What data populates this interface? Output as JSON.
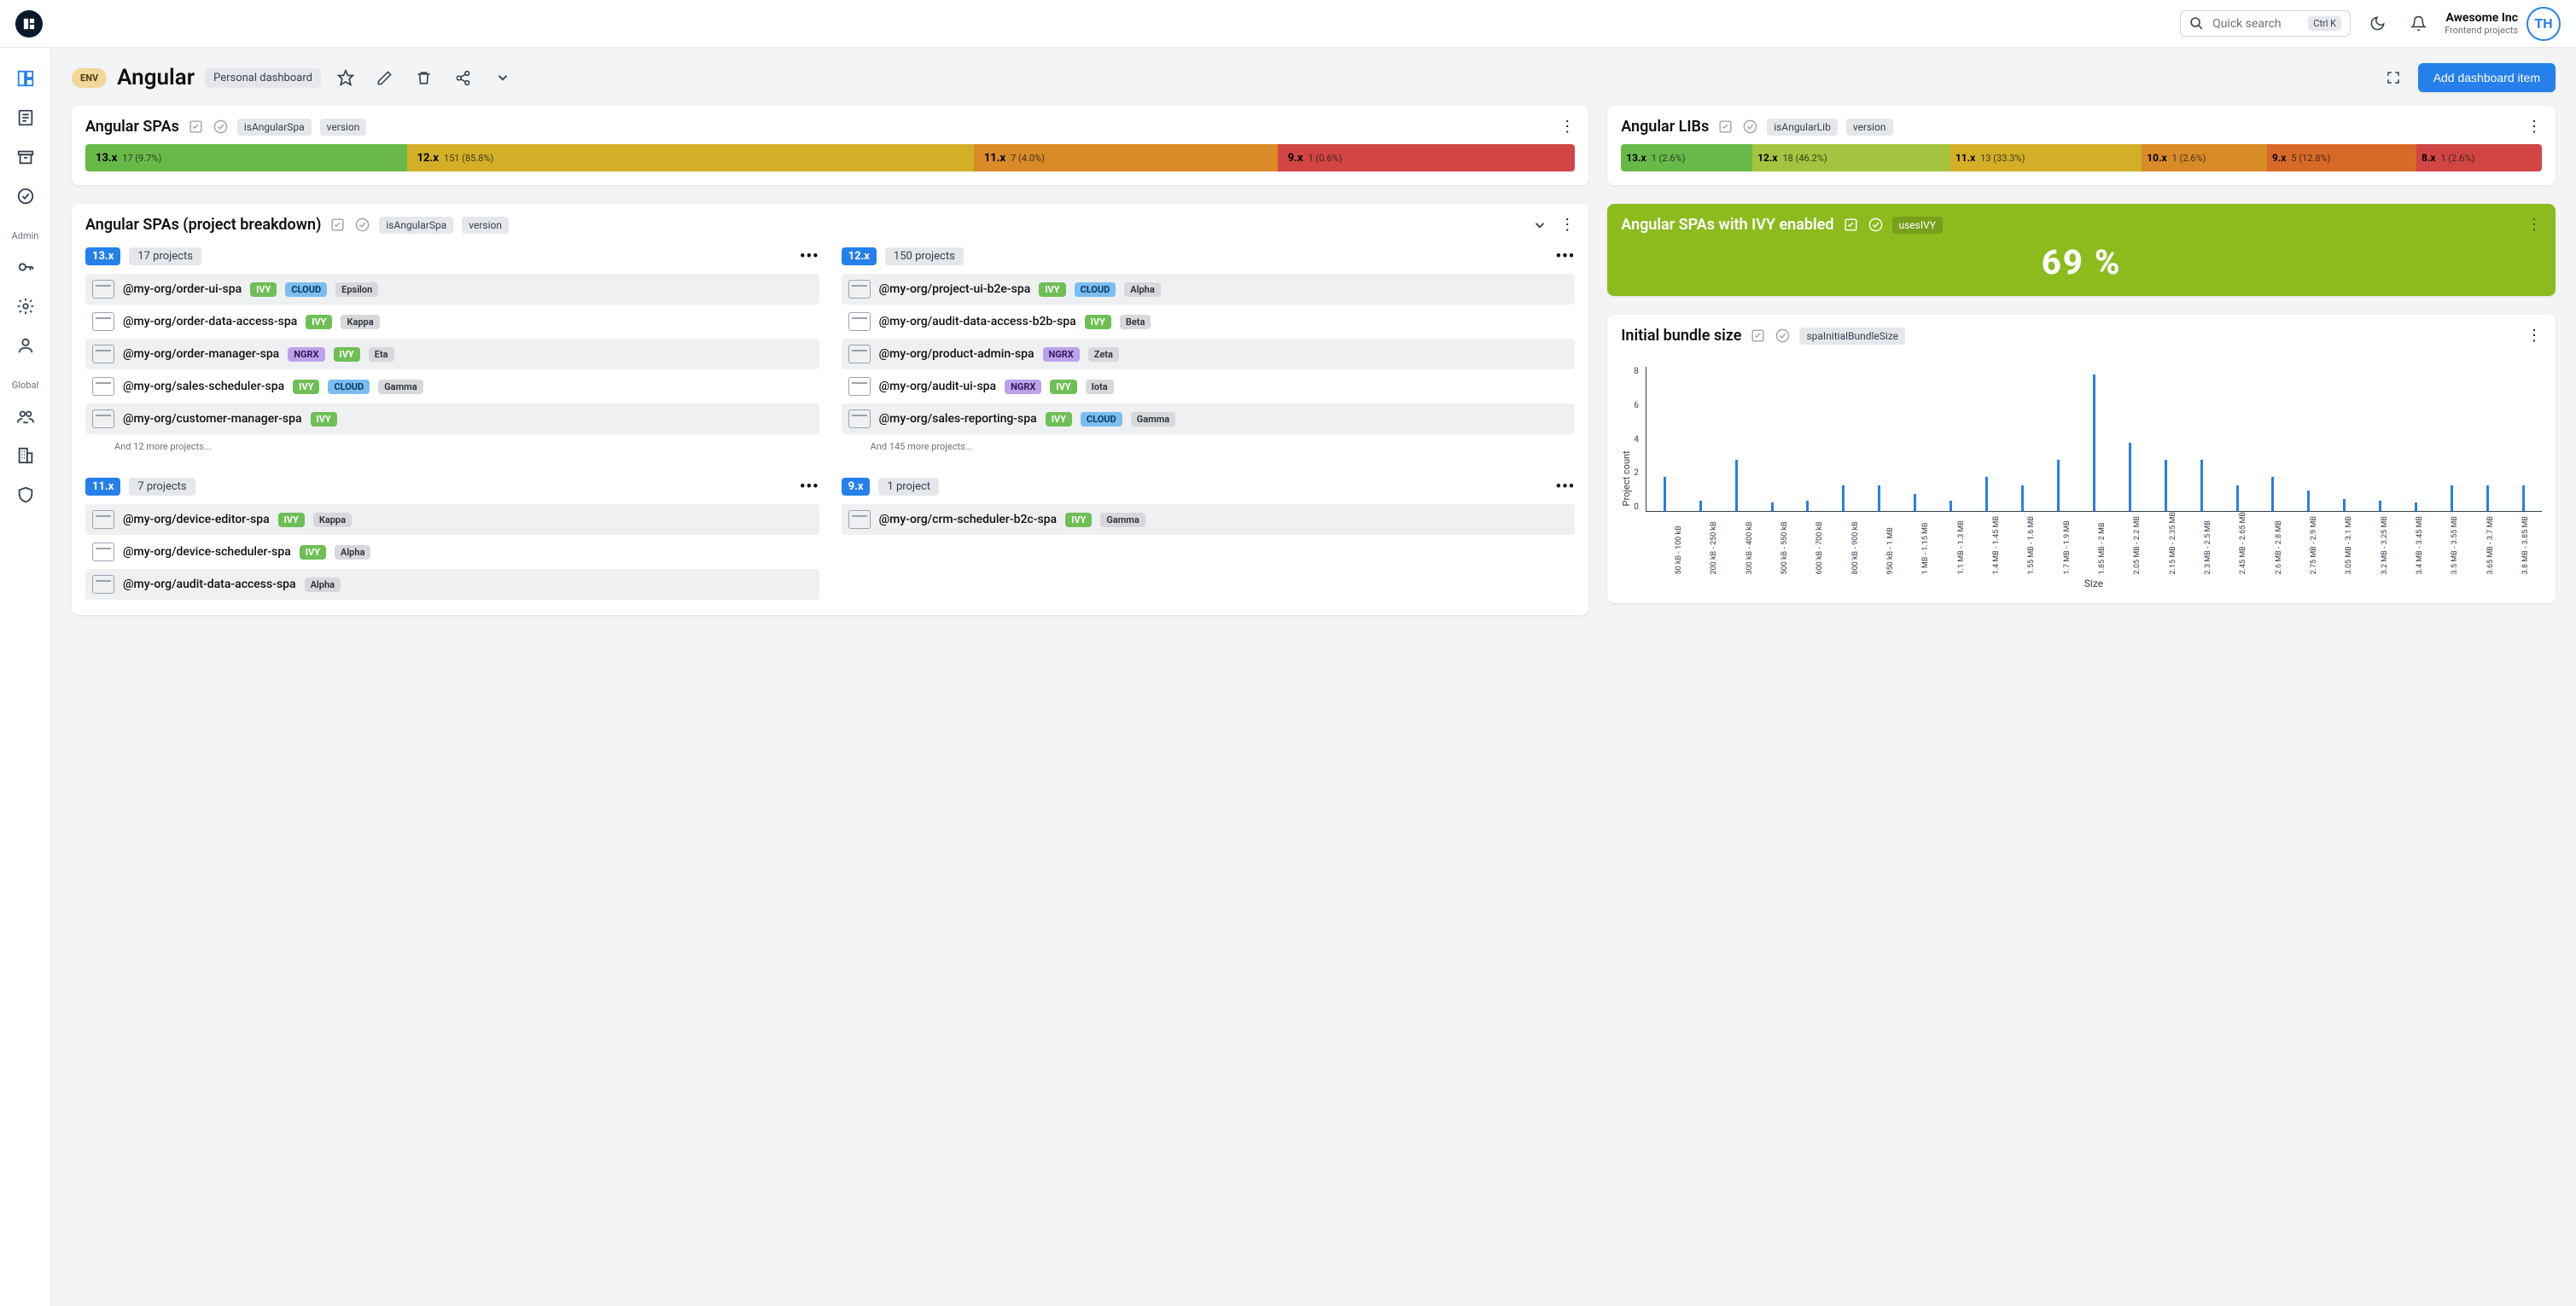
{
  "topbar": {
    "search_placeholder": "Quick search",
    "search_kbd": "Ctrl K",
    "account_name": "Awesome Inc",
    "account_sub": "Frontend projects",
    "avatar_initials": "TH"
  },
  "sidebar": {
    "section_admin": "Admin",
    "section_global": "Global"
  },
  "page": {
    "env_badge": "ENV",
    "title": "Angular",
    "subtitle_chip": "Personal dashboard",
    "add_button": "Add dashboard item"
  },
  "spas": {
    "title": "Angular SPAs",
    "filter_chip1": "isAngularSpa",
    "filter_chip2": "version",
    "segments": [
      {
        "ver": "13.x",
        "detail": "17 (9.7%)",
        "color": "#69b948",
        "grow": 19
      },
      {
        "ver": "12.x",
        "detail": "151 (85.8%)",
        "color": "#d3af27",
        "grow": 38
      },
      {
        "ver": "11.x",
        "detail": "7 (4.0%)",
        "color": "#d88b27",
        "grow": 18
      },
      {
        "ver": "9.x",
        "detail": "1 (0.6%)",
        "color": "#d24545",
        "grow": 18
      }
    ]
  },
  "libs": {
    "title": "Angular LIBs",
    "filter_chip1": "isAngularLib",
    "filter_chip2": "version",
    "segments": [
      {
        "ver": "13.x",
        "detail": "1 (2.6%)",
        "color": "#69b948",
        "grow": 10
      },
      {
        "ver": "12.x",
        "detail": "18 (46.2%)",
        "color": "#a5c33e",
        "grow": 19
      },
      {
        "ver": "11.x",
        "detail": "13 (33.3%)",
        "color": "#d3af27",
        "grow": 18
      },
      {
        "ver": "10.x",
        "detail": "1 (2.6%)",
        "color": "#d88b27",
        "grow": 9
      },
      {
        "ver": "9.x",
        "detail": "5 (12.8%)",
        "color": "#d86a27",
        "grow": 13
      },
      {
        "ver": "8.x",
        "detail": "1 (2.6%)",
        "color": "#d24545",
        "grow": 10
      }
    ]
  },
  "breakdown": {
    "title": "Angular SPAs (project breakdown)",
    "filter_chip1": "isAngularSpa",
    "filter_chip2": "version",
    "columns": [
      {
        "ver": "13.x",
        "count": "17 projects",
        "more": "And 12 more projects...",
        "projects": [
          {
            "name": "@my-org/order-ui-spa",
            "tags": [
              "ivy",
              "cloud"
            ],
            "team": "Epsilon",
            "alt": true
          },
          {
            "name": "@my-org/order-data-access-spa",
            "tags": [
              "ivy"
            ],
            "team": "Kappa",
            "alt": false
          },
          {
            "name": "@my-org/order-manager-spa",
            "tags": [
              "ngrx",
              "ivy"
            ],
            "team": "Eta",
            "alt": true
          },
          {
            "name": "@my-org/sales-scheduler-spa",
            "tags": [
              "ivy",
              "cloud"
            ],
            "team": "Gamma",
            "alt": false
          },
          {
            "name": "@my-org/customer-manager-spa",
            "tags": [
              "ivy"
            ],
            "team": "",
            "alt": true
          }
        ]
      },
      {
        "ver": "12.x",
        "count": "150 projects",
        "more": "And 145 more projects...",
        "projects": [
          {
            "name": "@my-org/project-ui-b2e-spa",
            "tags": [
              "ivy",
              "cloud"
            ],
            "team": "Alpha",
            "alt": true
          },
          {
            "name": "@my-org/audit-data-access-b2b-spa",
            "tags": [
              "ivy"
            ],
            "team": "Beta",
            "alt": false
          },
          {
            "name": "@my-org/product-admin-spa",
            "tags": [
              "ngrx"
            ],
            "team": "Zeta",
            "alt": true
          },
          {
            "name": "@my-org/audit-ui-spa",
            "tags": [
              "ngrx",
              "ivy"
            ],
            "team": "Iota",
            "alt": false
          },
          {
            "name": "@my-org/sales-reporting-spa",
            "tags": [
              "ivy",
              "cloud"
            ],
            "team": "Gamma",
            "alt": true
          }
        ]
      },
      {
        "ver": "11.x",
        "count": "7 projects",
        "more": "",
        "projects": [
          {
            "name": "@my-org/device-editor-spa",
            "tags": [
              "ivy"
            ],
            "team": "Kappa",
            "alt": true
          },
          {
            "name": "@my-org/device-scheduler-spa",
            "tags": [
              "ivy"
            ],
            "team": "Alpha",
            "alt": false
          },
          {
            "name": "@my-org/audit-data-access-spa",
            "tags": [],
            "team": "Alpha",
            "alt": true
          }
        ]
      },
      {
        "ver": "9.x",
        "count": "1 project",
        "more": "",
        "projects": [
          {
            "name": "@my-org/crm-scheduler-b2c-spa",
            "tags": [
              "ivy"
            ],
            "team": "Gamma",
            "alt": true
          }
        ]
      }
    ]
  },
  "ivy": {
    "title": "Angular SPAs with IVY enabled",
    "chip": "usesIVY",
    "value": "69 %"
  },
  "bundle": {
    "title": "Initial bundle size",
    "chip": "spaInitialBundleSize"
  },
  "chart_data": {
    "type": "bar",
    "title": "Initial bundle size",
    "xlabel": "Size",
    "ylabel": "Project count",
    "ylim": [
      0,
      8
    ],
    "yticks": [
      0,
      2,
      4,
      6,
      8
    ],
    "categories": [
      "50 kB - 100 kB",
      "200 kB - 250 kB",
      "300 kB - 400 kB",
      "500 kB - 550 kB",
      "600 kB - 700 kB",
      "800 kB - 900 kB",
      "950 kB - 1 MB",
      "1 MB - 1.15 MB",
      "1.1 MB - 1.3 MB",
      "1.4 MB - 1.45 MB",
      "1.55 MB - 1.6 MB",
      "1.7 MB - 1.9 MB",
      "1.85 MB - 2 MB",
      "2.05 MB - 2.2 MB",
      "2.15 MB - 2.35 MB",
      "2.3 MB - 2.5 MB",
      "2.45 MB - 2.65 MB",
      "2.6 MB - 2.8 MB",
      "2.75 MB - 2.9 MB",
      "3.05 MB - 3.1 MB",
      "3.2 MB - 3.25 MB",
      "3.4 MB - 3.45 MB",
      "3.5 MB - 3.55 MB",
      "3.65 MB - 3.7 MB",
      "3.8 MB - 3.85 MB"
    ],
    "values": [
      2,
      0.6,
      3,
      0.5,
      0.6,
      1.5,
      1.5,
      1,
      0.6,
      2,
      1.5,
      3,
      8,
      4,
      3,
      3,
      1.5,
      2,
      1.2,
      0.7,
      0.6,
      0.5,
      1.5,
      1.5,
      1.5
    ]
  },
  "tag_labels": {
    "ivy": "IVY",
    "cloud": "CLOUD",
    "ngrx": "NGRX"
  }
}
